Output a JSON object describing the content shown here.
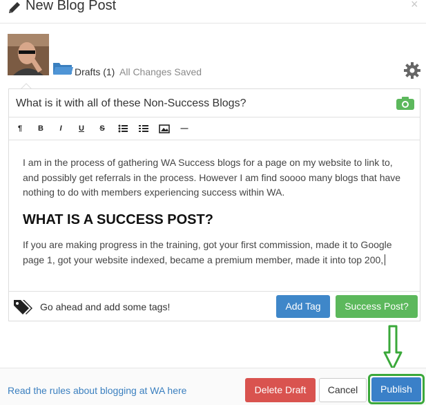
{
  "header": {
    "title": "New Blog Post",
    "close_glyph": "×"
  },
  "status": {
    "drafts_label": "Drafts (1)",
    "saved_label": "All Changes Saved"
  },
  "editor": {
    "title_value": "What is it with all of these Non-Success Blogs?",
    "toolbar": [
      {
        "name": "paragraph-icon",
        "glyph": "¶"
      },
      {
        "name": "bold-icon",
        "glyph": "B"
      },
      {
        "name": "italic-icon",
        "glyph": "I"
      },
      {
        "name": "underline-icon",
        "glyph": "U"
      },
      {
        "name": "strikethrough-icon",
        "glyph": "S"
      },
      {
        "name": "bullet-list-icon",
        "glyph": "list"
      },
      {
        "name": "numbered-list-icon",
        "glyph": "olist"
      },
      {
        "name": "image-icon",
        "glyph": "img"
      },
      {
        "name": "horizontal-rule-icon",
        "glyph": "—"
      }
    ],
    "paragraph1": "I am in the process of gathering WA Success blogs for a page on my website to link to, and possibly get referrals in the process. However I am find soooo many blogs that have nothing to do with members experiencing success within WA.",
    "heading": "WHAT IS A SUCCESS POST?",
    "paragraph2": "If you are making progress in the training, got your first commission, made it to Google page 1, got your website indexed, became a premium member, made it into top 200,"
  },
  "tags": {
    "placeholder": "Go ahead and add some tags!",
    "add_tag_label": "Add Tag",
    "success_post_label": "Success Post?"
  },
  "footer": {
    "rules_link": "Read the rules about blogging at WA here",
    "delete_label": "Delete Draft",
    "cancel_label": "Cancel",
    "publish_label": "Publish"
  },
  "colors": {
    "primary": "#3f87c9",
    "success": "#5cb85c",
    "danger": "#d9534f",
    "highlight": "#3aa83a"
  }
}
